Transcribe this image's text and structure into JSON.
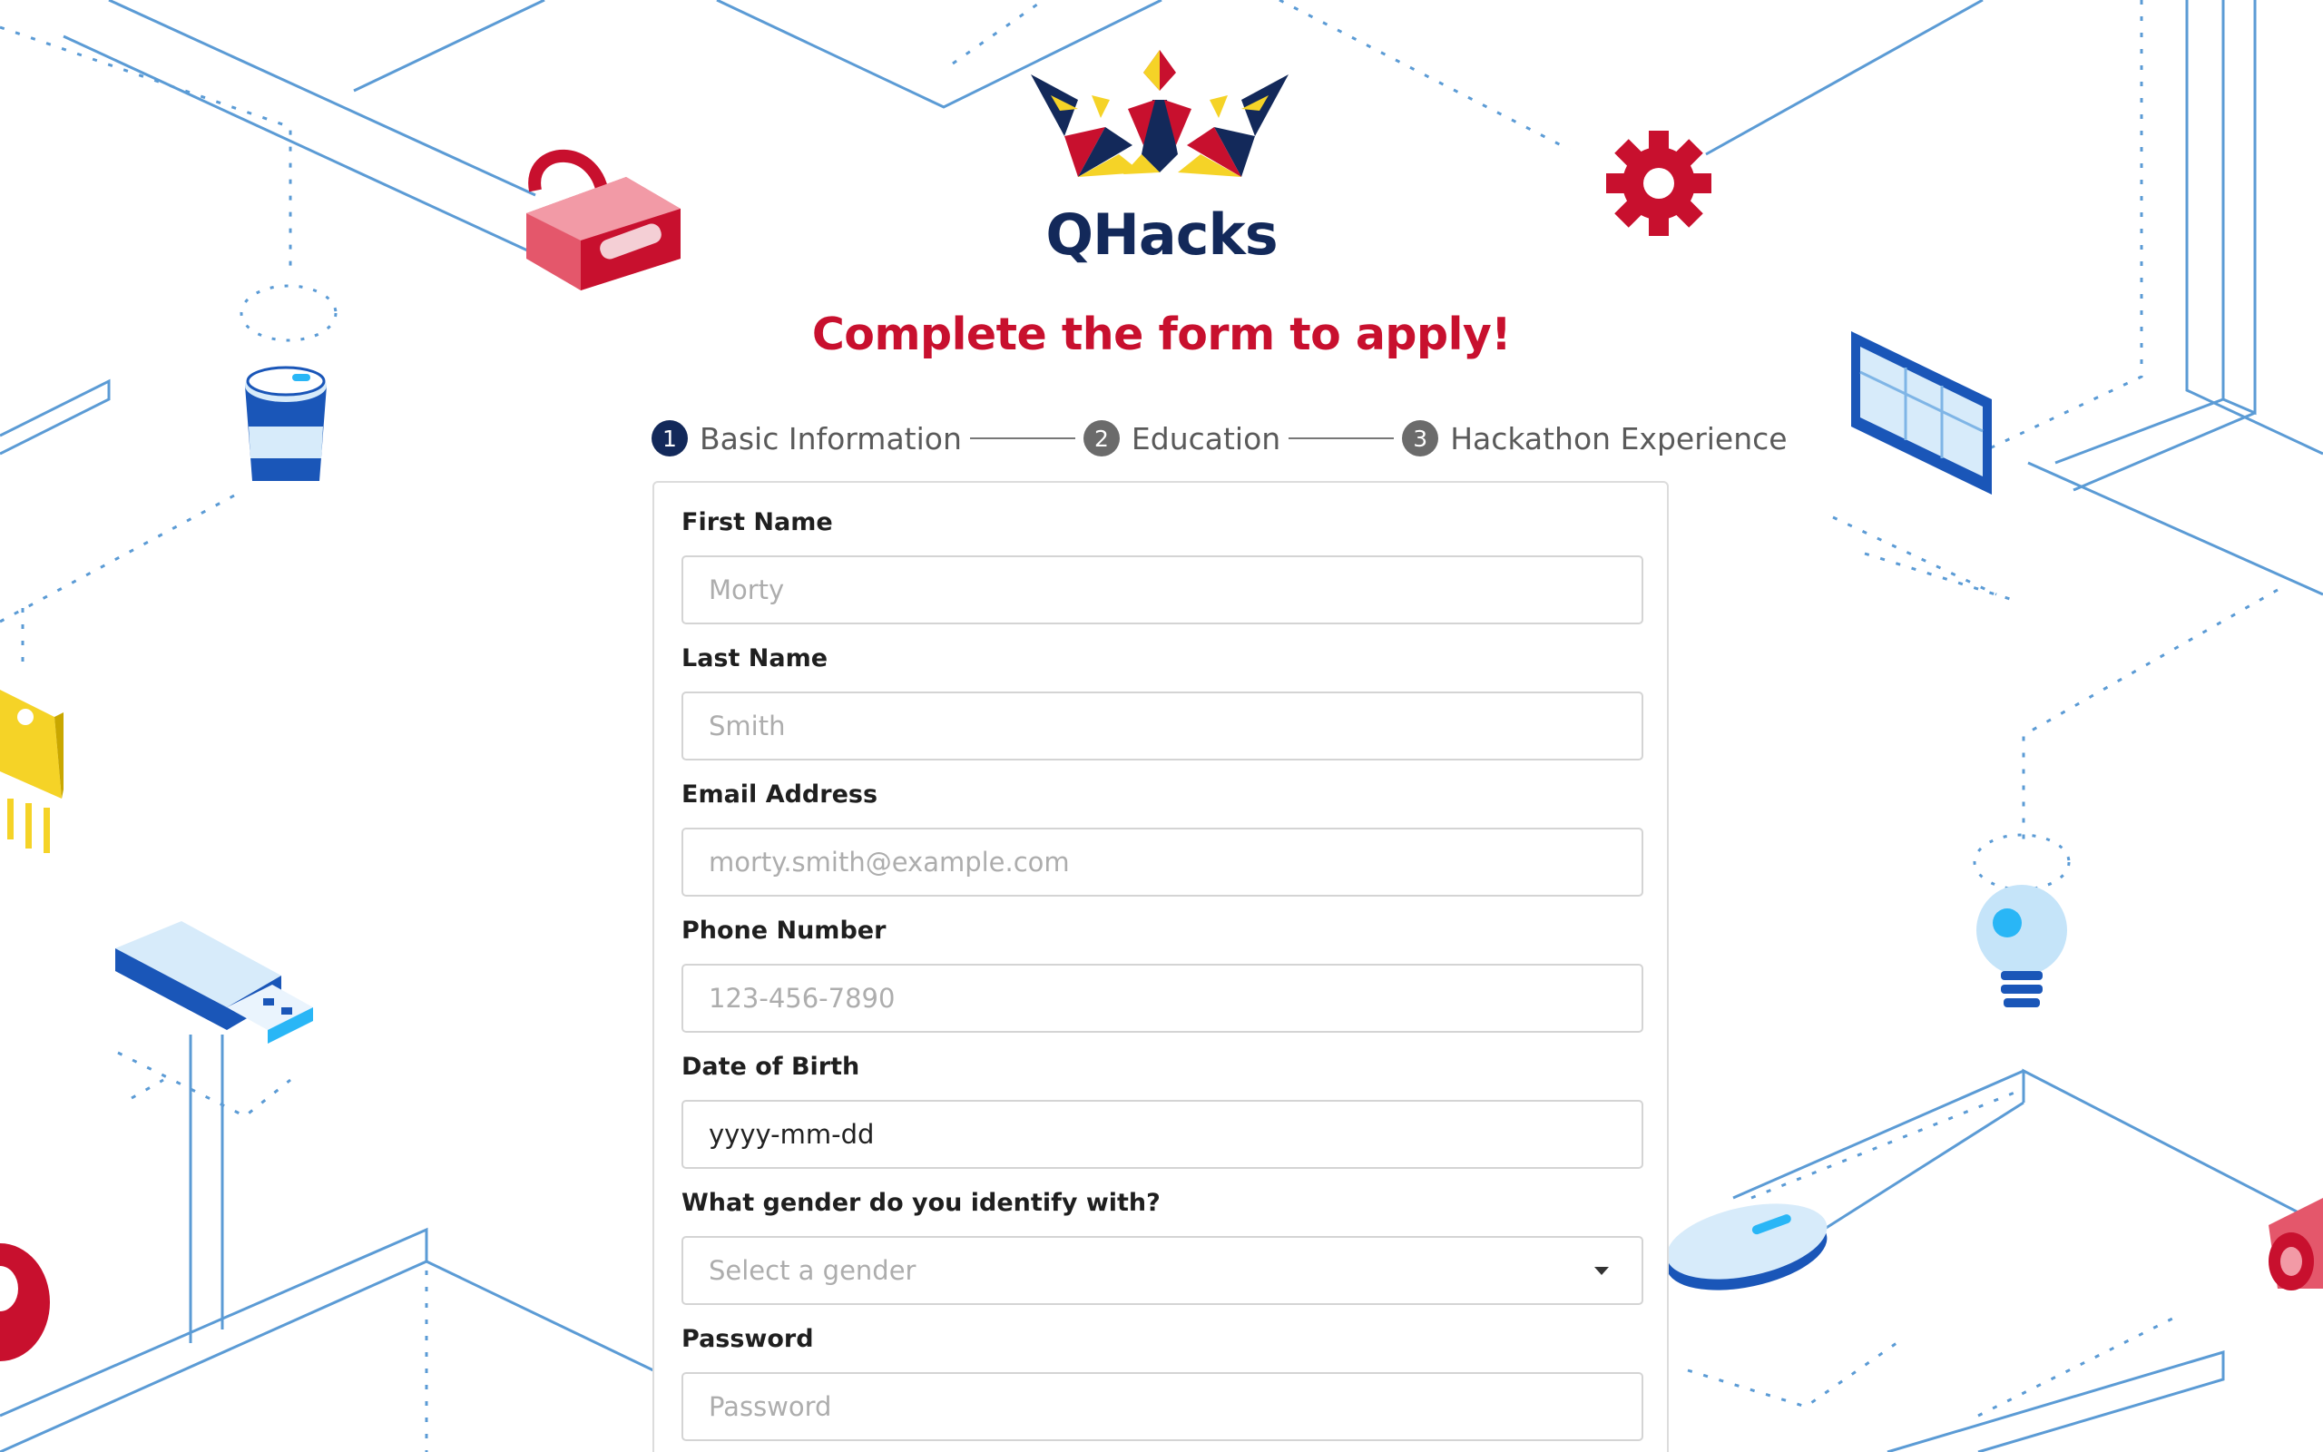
{
  "brand": {
    "name": "QHacks",
    "colors": {
      "navy": "#13295a",
      "red": "#c8102e",
      "gold": "#f5d327"
    }
  },
  "headline": "Complete the form to apply!",
  "steps": [
    {
      "number": "1",
      "label": "Basic Information",
      "active": true
    },
    {
      "number": "2",
      "label": "Education",
      "active": false
    },
    {
      "number": "3",
      "label": "Hackathon Experience",
      "active": false
    }
  ],
  "form": {
    "first_name": {
      "label": "First Name",
      "placeholder": "Morty"
    },
    "last_name": {
      "label": "Last Name",
      "placeholder": "Smith"
    },
    "email": {
      "label": "Email Address",
      "placeholder": "morty.smith@example.com"
    },
    "phone": {
      "label": "Phone Number",
      "placeholder": "123-456-7890"
    },
    "dob": {
      "label": "Date of Birth",
      "value": "yyyy-mm-dd"
    },
    "gender": {
      "label": "What gender do you identify with?",
      "placeholder": "Select a gender"
    },
    "password": {
      "label": "Password",
      "placeholder": "Password"
    }
  },
  "decorations": [
    "vr-headset-icon",
    "gear-icon",
    "coffee-cup-icon",
    "tablet-icon",
    "chip-icon",
    "usb-drive-icon",
    "lightbulb-icon",
    "mouse-icon",
    "circuit-lines"
  ]
}
